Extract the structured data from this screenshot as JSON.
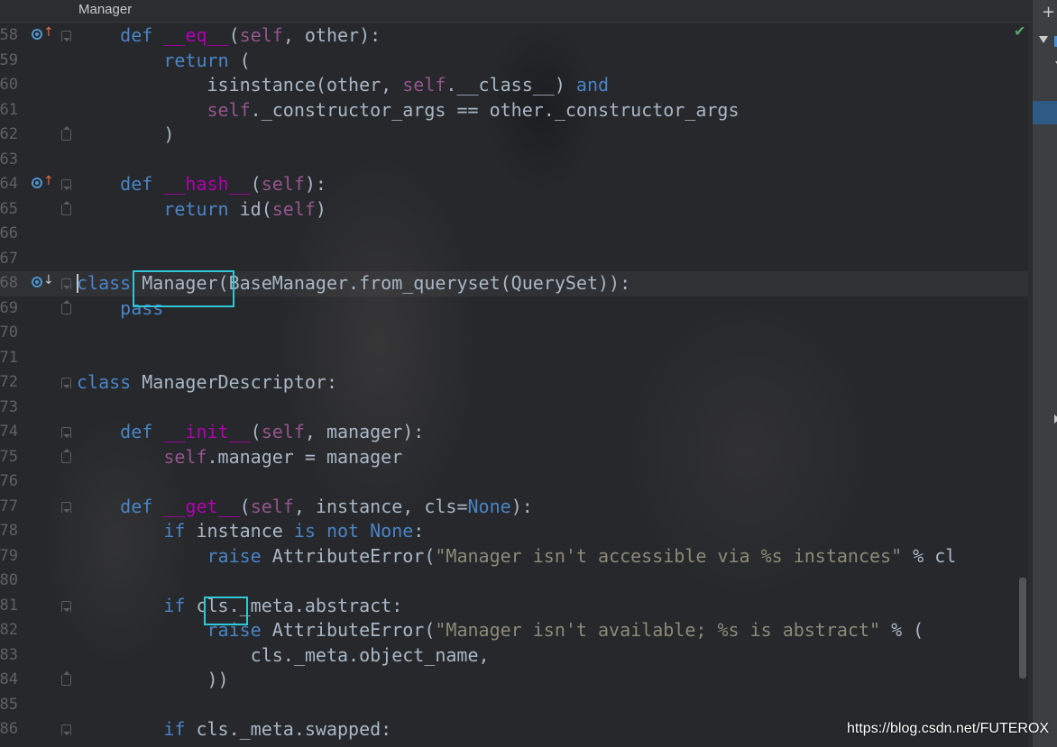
{
  "breadcrumb": {
    "label": "Manager"
  },
  "watermark": "https://blog.csdn.net/FUTEROX",
  "right_panel": {
    "plus_icon": "+"
  },
  "gutter": {
    "status_check": "✔"
  },
  "colors": {
    "keyword": "#4a84c7",
    "self": "#94558d",
    "dunder": "#b200b2",
    "string": "#8c8a78",
    "highlight": "#2ec8d8"
  },
  "lines": [
    {
      "num": "58",
      "tokens": [
        [
          "    ",
          ""
        ],
        [
          "def",
          "kw"
        ],
        [
          " ",
          ""
        ],
        [
          "__eq__",
          "dunder"
        ],
        [
          "(",
          ""
        ],
        [
          "self",
          "self"
        ],
        [
          ", other):",
          ""
        ]
      ]
    },
    {
      "num": "59",
      "tokens": [
        [
          "        ",
          ""
        ],
        [
          "return",
          "kw"
        ],
        [
          " (",
          ""
        ]
      ]
    },
    {
      "num": "60",
      "tokens": [
        [
          "            isinstance(other, ",
          ""
        ],
        [
          "self",
          "self"
        ],
        [
          ".__class__) ",
          ""
        ],
        [
          "and",
          "kw"
        ]
      ]
    },
    {
      "num": "61",
      "tokens": [
        [
          "            ",
          ""
        ],
        [
          "self",
          "self"
        ],
        [
          "._constructor_args == other._constructor_args",
          ""
        ]
      ]
    },
    {
      "num": "62",
      "tokens": [
        [
          "        )",
          ""
        ]
      ]
    },
    {
      "num": "63",
      "tokens": []
    },
    {
      "num": "64",
      "tokens": [
        [
          "    ",
          ""
        ],
        [
          "def",
          "kw"
        ],
        [
          " ",
          ""
        ],
        [
          "__hash__",
          "dunder"
        ],
        [
          "(",
          ""
        ],
        [
          "self",
          "self"
        ],
        [
          "):",
          ""
        ]
      ]
    },
    {
      "num": "65",
      "tokens": [
        [
          "        ",
          ""
        ],
        [
          "return",
          "kw"
        ],
        [
          " id(",
          ""
        ],
        [
          "self",
          "self"
        ],
        [
          ")",
          ""
        ]
      ]
    },
    {
      "num": "66",
      "tokens": []
    },
    {
      "num": "67",
      "tokens": []
    },
    {
      "num": "68",
      "tokens": [
        [
          "class",
          "kw"
        ],
        [
          " Manager(BaseManager.from_queryset(QuerySet)):",
          ""
        ]
      ]
    },
    {
      "num": "69",
      "tokens": [
        [
          "    ",
          ""
        ],
        [
          "pass",
          "kw"
        ]
      ]
    },
    {
      "num": "70",
      "tokens": []
    },
    {
      "num": "71",
      "tokens": []
    },
    {
      "num": "72",
      "tokens": [
        [
          "class",
          "kw"
        ],
        [
          " ManagerDescriptor:",
          ""
        ]
      ]
    },
    {
      "num": "73",
      "tokens": []
    },
    {
      "num": "74",
      "tokens": [
        [
          "    ",
          ""
        ],
        [
          "def",
          "kw"
        ],
        [
          " ",
          ""
        ],
        [
          "__init__",
          "dunder"
        ],
        [
          "(",
          ""
        ],
        [
          "self",
          "self"
        ],
        [
          ", manager):",
          ""
        ]
      ]
    },
    {
      "num": "75",
      "tokens": [
        [
          "        ",
          ""
        ],
        [
          "self",
          "self"
        ],
        [
          ".manager = manager",
          ""
        ]
      ]
    },
    {
      "num": "76",
      "tokens": []
    },
    {
      "num": "77",
      "tokens": [
        [
          "    ",
          ""
        ],
        [
          "def",
          "kw"
        ],
        [
          " ",
          ""
        ],
        [
          "__get__",
          "dunder"
        ],
        [
          "(",
          ""
        ],
        [
          "self",
          "self"
        ],
        [
          ", instance, cls=",
          ""
        ],
        [
          "None",
          "kw"
        ],
        [
          "):",
          ""
        ]
      ]
    },
    {
      "num": "78",
      "tokens": [
        [
          "        ",
          ""
        ],
        [
          "if",
          "kw"
        ],
        [
          " instance ",
          ""
        ],
        [
          "is not None",
          "kw"
        ],
        [
          ":",
          ""
        ]
      ]
    },
    {
      "num": "79",
      "tokens": [
        [
          "            ",
          ""
        ],
        [
          "raise",
          "kw"
        ],
        [
          " AttributeError(",
          ""
        ],
        [
          "\"Manager isn't accessible via %s instances\"",
          "str"
        ],
        [
          " % cl",
          ""
        ]
      ]
    },
    {
      "num": "80",
      "tokens": []
    },
    {
      "num": "81",
      "tokens": [
        [
          "        ",
          ""
        ],
        [
          "if",
          "kw"
        ],
        [
          " cls._meta.abstract:",
          ""
        ]
      ]
    },
    {
      "num": "82",
      "tokens": [
        [
          "            ",
          ""
        ],
        [
          "raise",
          "kw"
        ],
        [
          " AttributeError(",
          ""
        ],
        [
          "\"Manager isn't available; %s is abstract\"",
          "str"
        ],
        [
          " % (",
          ""
        ]
      ]
    },
    {
      "num": "83",
      "tokens": [
        [
          "                cls._meta.object_name,",
          ""
        ]
      ]
    },
    {
      "num": "84",
      "tokens": [
        [
          "            ))",
          ""
        ]
      ]
    },
    {
      "num": "85",
      "tokens": []
    },
    {
      "num": "86",
      "tokens": [
        [
          "        ",
          ""
        ],
        [
          "if",
          "kw"
        ],
        [
          " cls._meta.swapped:",
          ""
        ]
      ]
    }
  ]
}
